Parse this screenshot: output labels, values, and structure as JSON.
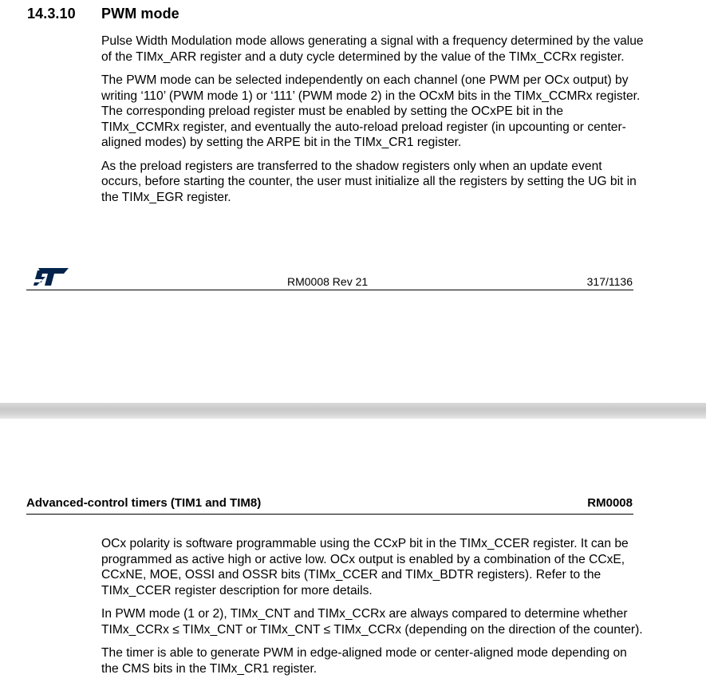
{
  "page1": {
    "section_number": "14.3.10",
    "section_title": "PWM mode",
    "paragraphs": [
      "Pulse Width Modulation mode allows generating a signal with a frequency determined by the value of the TIMx_ARR register and a duty cycle determined by the value of the TIMx_CCRx register.",
      "The PWM mode can be selected independently on each channel (one PWM per OCx output) by writing ‘110’ (PWM mode 1) or ‘111’ (PWM mode 2) in the OCxM bits in the TIMx_CCMRx register. The corresponding preload register must be enabled by setting the OCxPE bit in the TIMx_CCMRx register, and eventually the auto-reload preload register (in upcounting or center-aligned modes) by setting the ARPE bit in the TIMx_CR1 register.",
      "As the preload registers are transferred to the shadow registers only when an update event occurs, before starting the counter, the user must initialize all the registers by setting the UG bit in the TIMx_EGR register."
    ],
    "footer": {
      "logo_icon": "st-logo-icon",
      "document_revision": "RM0008 Rev 21",
      "page_number": "317/1136"
    }
  },
  "page2": {
    "header": {
      "title": "Advanced-control timers (TIM1 and TIM8)",
      "document_code": "RM0008"
    },
    "paragraphs": [
      "OCx polarity is software programmable using the CCxP bit in the TIMx_CCER register. It can be programmed as active high or active low. OCx output is enabled by a combination of the CCxE, CCxNE, MOE, OSSI and OSSR bits (TIMx_CCER and TIMx_BDTR registers). Refer to the TIMx_CCER register description for more details.",
      "In PWM mode (1 or 2), TIMx_CNT and TIMx_CCRx are always compared to determine whether TIMx_CCRx ≤ TIMx_CNT or TIMx_CNT ≤ TIMx_CCRx (depending on the direction of the counter).",
      "The timer is able to generate PWM in edge-aligned mode or center-aligned mode depending on the CMS bits in the TIMx_CR1 register."
    ]
  }
}
